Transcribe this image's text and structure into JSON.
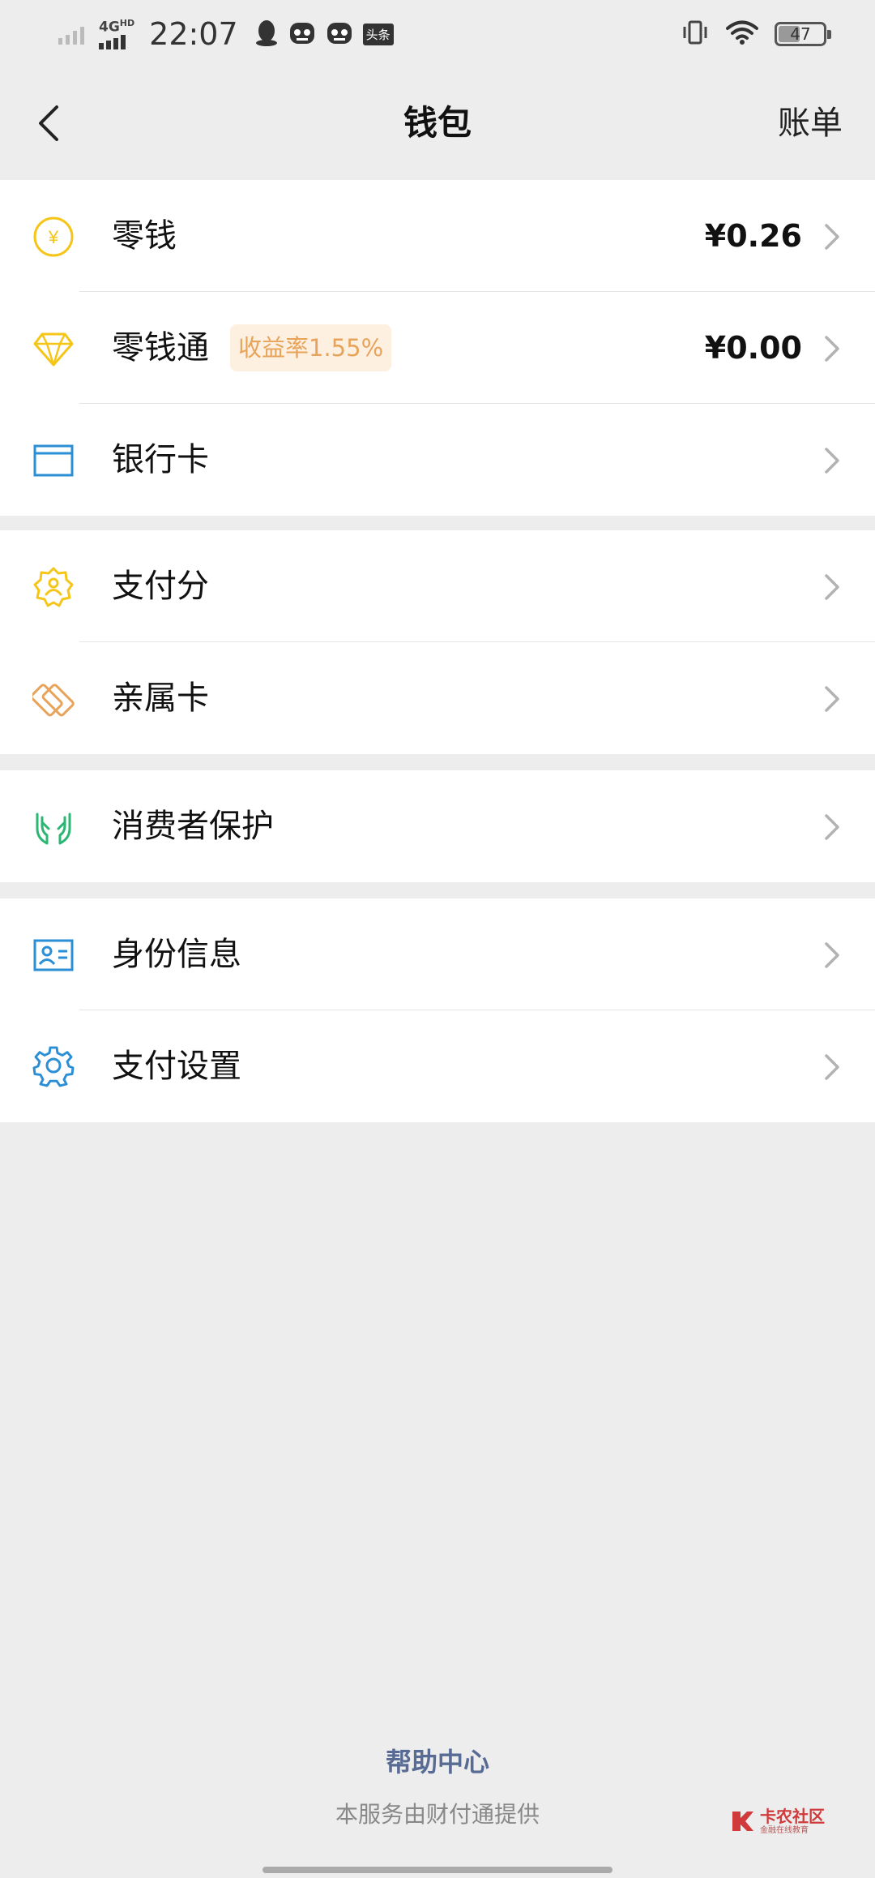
{
  "status_bar": {
    "network": "4G",
    "network_sup": "HD",
    "time": "22:07",
    "app_badge": "头条",
    "battery": "47"
  },
  "nav": {
    "title": "钱包",
    "bill": "账单"
  },
  "groups": [
    {
      "rows": [
        {
          "icon": "yuan-coin-icon",
          "label": "零钱",
          "value": "¥0.26"
        },
        {
          "icon": "diamond-icon",
          "label": "零钱通",
          "badge": "收益率1.55%",
          "value": "¥0.00"
        },
        {
          "icon": "bank-card-icon",
          "label": "银行卡"
        }
      ]
    },
    {
      "rows": [
        {
          "icon": "pay-score-badge-icon",
          "label": "支付分"
        },
        {
          "icon": "family-card-icon",
          "label": "亲属卡"
        }
      ]
    },
    {
      "rows": [
        {
          "icon": "protect-hands-icon",
          "label": "消费者保护"
        }
      ]
    },
    {
      "rows": [
        {
          "icon": "id-card-icon",
          "label": "身份信息"
        },
        {
          "icon": "gear-icon",
          "label": "支付设置"
        }
      ]
    }
  ],
  "footer": {
    "help": "帮助中心",
    "provider": "本服务由财付通提供"
  },
  "watermark": {
    "main": "卡农社区",
    "sub": "金融在线教育"
  },
  "colors": {
    "background": "#ededed",
    "yellow_icon": "#f5c518",
    "orange_icon": "#e8a35a",
    "green_icon": "#2bb673",
    "blue_icon": "#2b8fd6",
    "link_blue": "#576b95"
  }
}
